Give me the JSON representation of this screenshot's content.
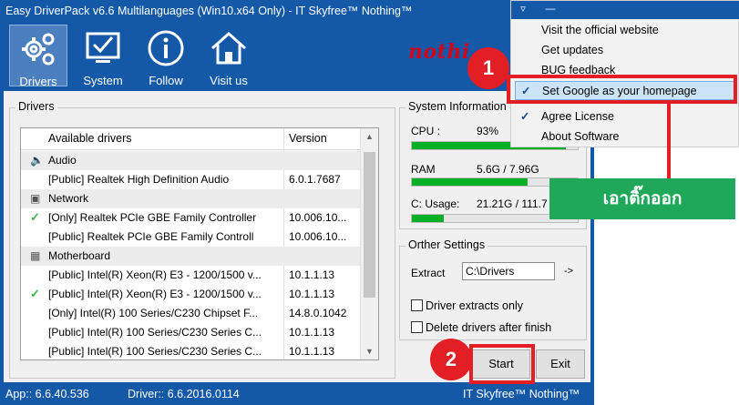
{
  "window": {
    "title": "Easy DriverPack v6.6 Multilanguages (Win10.x64 Only) - IT Skyfree™  Nothing™",
    "logo_text": "nothi"
  },
  "toolbar": {
    "items": [
      {
        "label": "Drivers",
        "icon": "gears-icon"
      },
      {
        "label": "System",
        "icon": "monitor-check-icon"
      },
      {
        "label": "Follow",
        "icon": "info-icon"
      },
      {
        "label": "Visit us",
        "icon": "home-icon"
      }
    ]
  },
  "drivers": {
    "group_title": "Drivers",
    "columns": [
      "Available drivers",
      "Version"
    ],
    "rows": [
      {
        "type": "category",
        "name": "Audio",
        "icon": "speaker-icon"
      },
      {
        "type": "driver",
        "name": "[Public] Realtek High Definition Audio",
        "version": "6.0.1.7687",
        "checked": false
      },
      {
        "type": "category",
        "name": "Network",
        "icon": "network-icon"
      },
      {
        "type": "driver",
        "name": "[Only] Realtek PCIe GBE Family Controller",
        "version": "10.006.10...",
        "checked": true
      },
      {
        "type": "driver",
        "name": "[Public] Realtek PCIe GBE Family Controll",
        "version": "10.006.10...",
        "checked": false
      },
      {
        "type": "category",
        "name": "Motherboard",
        "icon": "chip-icon"
      },
      {
        "type": "driver",
        "name": "[Public] Intel(R) Xeon(R) E3 - 1200/1500 v...",
        "version": "10.1.1.13",
        "checked": false
      },
      {
        "type": "driver",
        "name": "[Public] Intel(R) Xeon(R) E3 - 1200/1500 v...",
        "version": "10.1.1.13",
        "checked": true
      },
      {
        "type": "driver",
        "name": "[Only] Intel(R) 100 Series/C230 Chipset F...",
        "version": "14.8.0.1042",
        "checked": false
      },
      {
        "type": "driver",
        "name": "[Public] Intel(R) 100 Series/C230 Series C...",
        "version": "10.1.1.13",
        "checked": false
      },
      {
        "type": "driver",
        "name": "[Public] Intel(R) 100 Series/C230 Series C...",
        "version": "10.1.1.13",
        "checked": false
      }
    ]
  },
  "system_info": {
    "group_title": "System Information",
    "cpu": {
      "label": "CPU :",
      "value": "93%",
      "fraction": 0.93
    },
    "ram": {
      "label": "RAM",
      "value": "5.6G / 7.96G",
      "fraction": 0.7
    },
    "disk": {
      "label": "C: Usage:",
      "value": "21.21G / 111.7",
      "fraction": 0.19
    }
  },
  "other_settings": {
    "group_title": "Orther Settings",
    "extract_label": "Extract",
    "extract_value": "C:\\Drivers",
    "extract_go": "->",
    "options": [
      {
        "label": "Driver extracts only",
        "checked": false
      },
      {
        "label": "Delete drivers after finish",
        "checked": false
      }
    ]
  },
  "buttons": {
    "start": "Start",
    "exit": "Exit"
  },
  "statusbar": {
    "app": "App:: 6.6.40.536",
    "driver": "Driver:: 6.6.2016.0114",
    "brand": "IT Skyfree™  Nothing™"
  },
  "menu": {
    "top_buttons": [
      "▿",
      "—"
    ],
    "items": [
      {
        "label": "Visit the official website",
        "checked": false,
        "highlighted": false
      },
      {
        "label": "Get updates",
        "checked": false,
        "highlighted": false
      },
      {
        "label": "BUG feedback",
        "checked": false,
        "highlighted": false
      },
      {
        "label": "Set Google as your homepage",
        "checked": true,
        "highlighted": true
      },
      {
        "label": "Agree License",
        "checked": true,
        "highlighted": false
      },
      {
        "label": "About Software",
        "checked": false,
        "highlighted": false
      }
    ]
  },
  "annotations": {
    "step1": "1",
    "step2": "2",
    "callout": "เอาติ๊กออก",
    "accent_red": "#e31e24",
    "callout_green": "#1fa85a"
  },
  "colors": {
    "window_blue": "#1459a8",
    "progress_green": "#06b025"
  }
}
